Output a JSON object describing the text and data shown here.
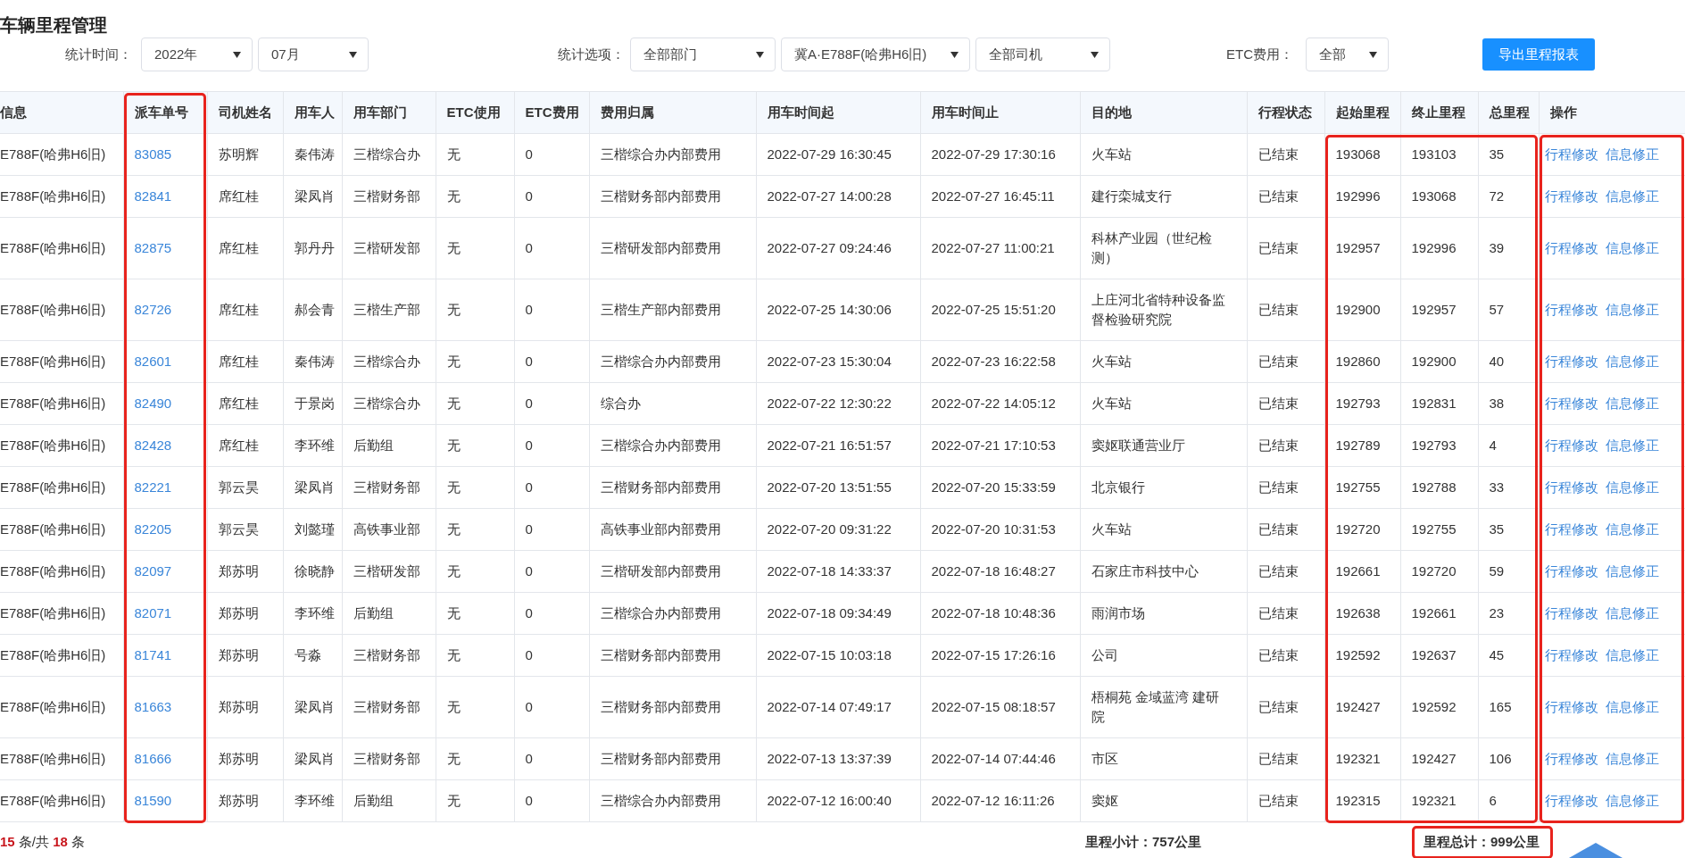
{
  "title": "车辆里程管理",
  "filters": {
    "time_label": "统计时间：",
    "year": "2022年",
    "month": "07月",
    "option_label": "统计选项：",
    "department": "全部部门",
    "vehicle": "冀A·E788F(哈弗H6旧)",
    "driver": "全部司机",
    "etc_label": "ETC费用：",
    "etc": "全部",
    "export_button": "导出里程报表"
  },
  "table": {
    "columns": [
      {
        "label": "信息"
      },
      {
        "label": "派车单号"
      },
      {
        "label": "司机姓名"
      },
      {
        "label": "用车人"
      },
      {
        "label": "用车部门"
      },
      {
        "label": "ETC使用"
      },
      {
        "label": "ETC费用"
      },
      {
        "label": "费用归属"
      },
      {
        "label": "用车时间起"
      },
      {
        "label": "用车时间止"
      },
      {
        "label": "目的地"
      },
      {
        "label": "行程状态"
      },
      {
        "label": "起始里程"
      },
      {
        "label": "终止里程"
      },
      {
        "label": "总里程"
      },
      {
        "label": "操作"
      }
    ],
    "highlight_frames": [
      {
        "with_header": true
      },
      {
        "with_header": false
      },
      {
        "with_header": false
      }
    ],
    "rows": [
      {
        "cells": [
          "E788F(哈弗H6旧)",
          "83085",
          "苏明辉",
          "秦伟涛",
          "三楷综合办",
          "无",
          "0",
          "三楷综合办内部费用",
          "2022-07-29 16:30:45",
          "2022-07-29 17:30:16",
          "火车站",
          "已结束",
          "193068",
          "193103",
          "35"
        ],
        "actions": [
          "行程修改",
          "信息修正"
        ]
      },
      {
        "cells": [
          "E788F(哈弗H6旧)",
          "82841",
          "席红桂",
          "梁凤肖",
          "三楷财务部",
          "无",
          "0",
          "三楷财务部内部费用",
          "2022-07-27 14:00:28",
          "2022-07-27 16:45:11",
          "建行栾城支行",
          "已结束",
          "192996",
          "193068",
          "72"
        ],
        "actions": [
          "行程修改",
          "信息修正"
        ]
      },
      {
        "cells": [
          "E788F(哈弗H6旧)",
          "82875",
          "席红桂",
          "郭丹丹",
          "三楷研发部",
          "无",
          "0",
          "三楷研发部内部费用",
          "2022-07-27 09:24:46",
          "2022-07-27 11:00:21",
          "科林产业园（世纪检测）",
          "已结束",
          "192957",
          "192996",
          "39"
        ],
        "actions": [
          "行程修改",
          "信息修正"
        ]
      },
      {
        "cells": [
          "E788F(哈弗H6旧)",
          "82726",
          "席红桂",
          "郝会青",
          "三楷生产部",
          "无",
          "0",
          "三楷生产部内部费用",
          "2022-07-25 14:30:06",
          "2022-07-25 15:51:20",
          "上庄河北省特种设备监督检验研究院",
          "已结束",
          "192900",
          "192957",
          "57"
        ],
        "actions": [
          "行程修改",
          "信息修正"
        ]
      },
      {
        "cells": [
          "E788F(哈弗H6旧)",
          "82601",
          "席红桂",
          "秦伟涛",
          "三楷综合办",
          "无",
          "0",
          "三楷综合办内部费用",
          "2022-07-23 15:30:04",
          "2022-07-23 16:22:58",
          "火车站",
          "已结束",
          "192860",
          "192900",
          "40"
        ],
        "actions": [
          "行程修改",
          "信息修正"
        ]
      },
      {
        "cells": [
          "E788F(哈弗H6旧)",
          "82490",
          "席红桂",
          "于景岗",
          "三楷综合办",
          "无",
          "0",
          "综合办",
          "2022-07-22 12:30:22",
          "2022-07-22 14:05:12",
          "火车站",
          "已结束",
          "192793",
          "192831",
          "38"
        ],
        "actions": [
          "行程修改",
          "信息修正"
        ]
      },
      {
        "cells": [
          "E788F(哈弗H6旧)",
          "82428",
          "席红桂",
          "李环维",
          "后勤组",
          "无",
          "0",
          "三楷综合办内部费用",
          "2022-07-21 16:51:57",
          "2022-07-21 17:10:53",
          "窦妪联通营业厅",
          "已结束",
          "192789",
          "192793",
          "4"
        ],
        "actions": [
          "行程修改",
          "信息修正"
        ]
      },
      {
        "cells": [
          "E788F(哈弗H6旧)",
          "82221",
          "郭云昊",
          "梁凤肖",
          "三楷财务部",
          "无",
          "0",
          "三楷财务部内部费用",
          "2022-07-20 13:51:55",
          "2022-07-20 15:33:59",
          "北京银行",
          "已结束",
          "192755",
          "192788",
          "33"
        ],
        "actions": [
          "行程修改",
          "信息修正"
        ]
      },
      {
        "cells": [
          "E788F(哈弗H6旧)",
          "82205",
          "郭云昊",
          "刘懿瑾",
          "高铁事业部",
          "无",
          "0",
          "高铁事业部内部费用",
          "2022-07-20 09:31:22",
          "2022-07-20 10:31:53",
          "火车站",
          "已结束",
          "192720",
          "192755",
          "35"
        ],
        "actions": [
          "行程修改",
          "信息修正"
        ]
      },
      {
        "cells": [
          "E788F(哈弗H6旧)",
          "82097",
          "郑苏明",
          "徐晓静",
          "三楷研发部",
          "无",
          "0",
          "三楷研发部内部费用",
          "2022-07-18 14:33:37",
          "2022-07-18 16:48:27",
          "石家庄市科技中心",
          "已结束",
          "192661",
          "192720",
          "59"
        ],
        "actions": [
          "行程修改",
          "信息修正"
        ]
      },
      {
        "cells": [
          "E788F(哈弗H6旧)",
          "82071",
          "郑苏明",
          "李环维",
          "后勤组",
          "无",
          "0",
          "三楷综合办内部费用",
          "2022-07-18 09:34:49",
          "2022-07-18 10:48:36",
          "雨润市场",
          "已结束",
          "192638",
          "192661",
          "23"
        ],
        "actions": [
          "行程修改",
          "信息修正"
        ]
      },
      {
        "cells": [
          "E788F(哈弗H6旧)",
          "81741",
          "郑苏明",
          "号淼",
          "三楷财务部",
          "无",
          "0",
          "三楷财务部内部费用",
          "2022-07-15 10:03:18",
          "2022-07-15 17:26:16",
          "公司",
          "已结束",
          "192592",
          "192637",
          "45"
        ],
        "actions": [
          "行程修改",
          "信息修正"
        ]
      },
      {
        "cells": [
          "E788F(哈弗H6旧)",
          "81663",
          "郑苏明",
          "梁凤肖",
          "三楷财务部",
          "无",
          "0",
          "三楷财务部内部费用",
          "2022-07-14 07:49:17",
          "2022-07-15 08:18:57",
          "梧桐苑 金域蓝湾 建研院",
          "已结束",
          "192427",
          "192592",
          "165"
        ],
        "actions": [
          "行程修改",
          "信息修正"
        ]
      },
      {
        "cells": [
          "E788F(哈弗H6旧)",
          "81666",
          "郑苏明",
          "梁凤肖",
          "三楷财务部",
          "无",
          "0",
          "三楷财务部内部费用",
          "2022-07-13 13:37:39",
          "2022-07-14 07:44:46",
          "市区",
          "已结束",
          "192321",
          "192427",
          "106"
        ],
        "actions": [
          "行程修改",
          "信息修正"
        ]
      },
      {
        "cells": [
          "E788F(哈弗H6旧)",
          "81590",
          "郑苏明",
          "李环维",
          "后勤组",
          "无",
          "0",
          "三楷综合办内部费用",
          "2022-07-12 16:00:40",
          "2022-07-12 16:11:26",
          "窦妪",
          "已结束",
          "192315",
          "192321",
          "6"
        ],
        "actions": [
          "行程修改",
          "信息修正"
        ]
      }
    ]
  },
  "footer": {
    "count": "**15** 条/共 **18** 条",
    "subtotal": "里程小计：757公里",
    "total": "里程总计：999公里",
    "total_framed": true
  }
}
